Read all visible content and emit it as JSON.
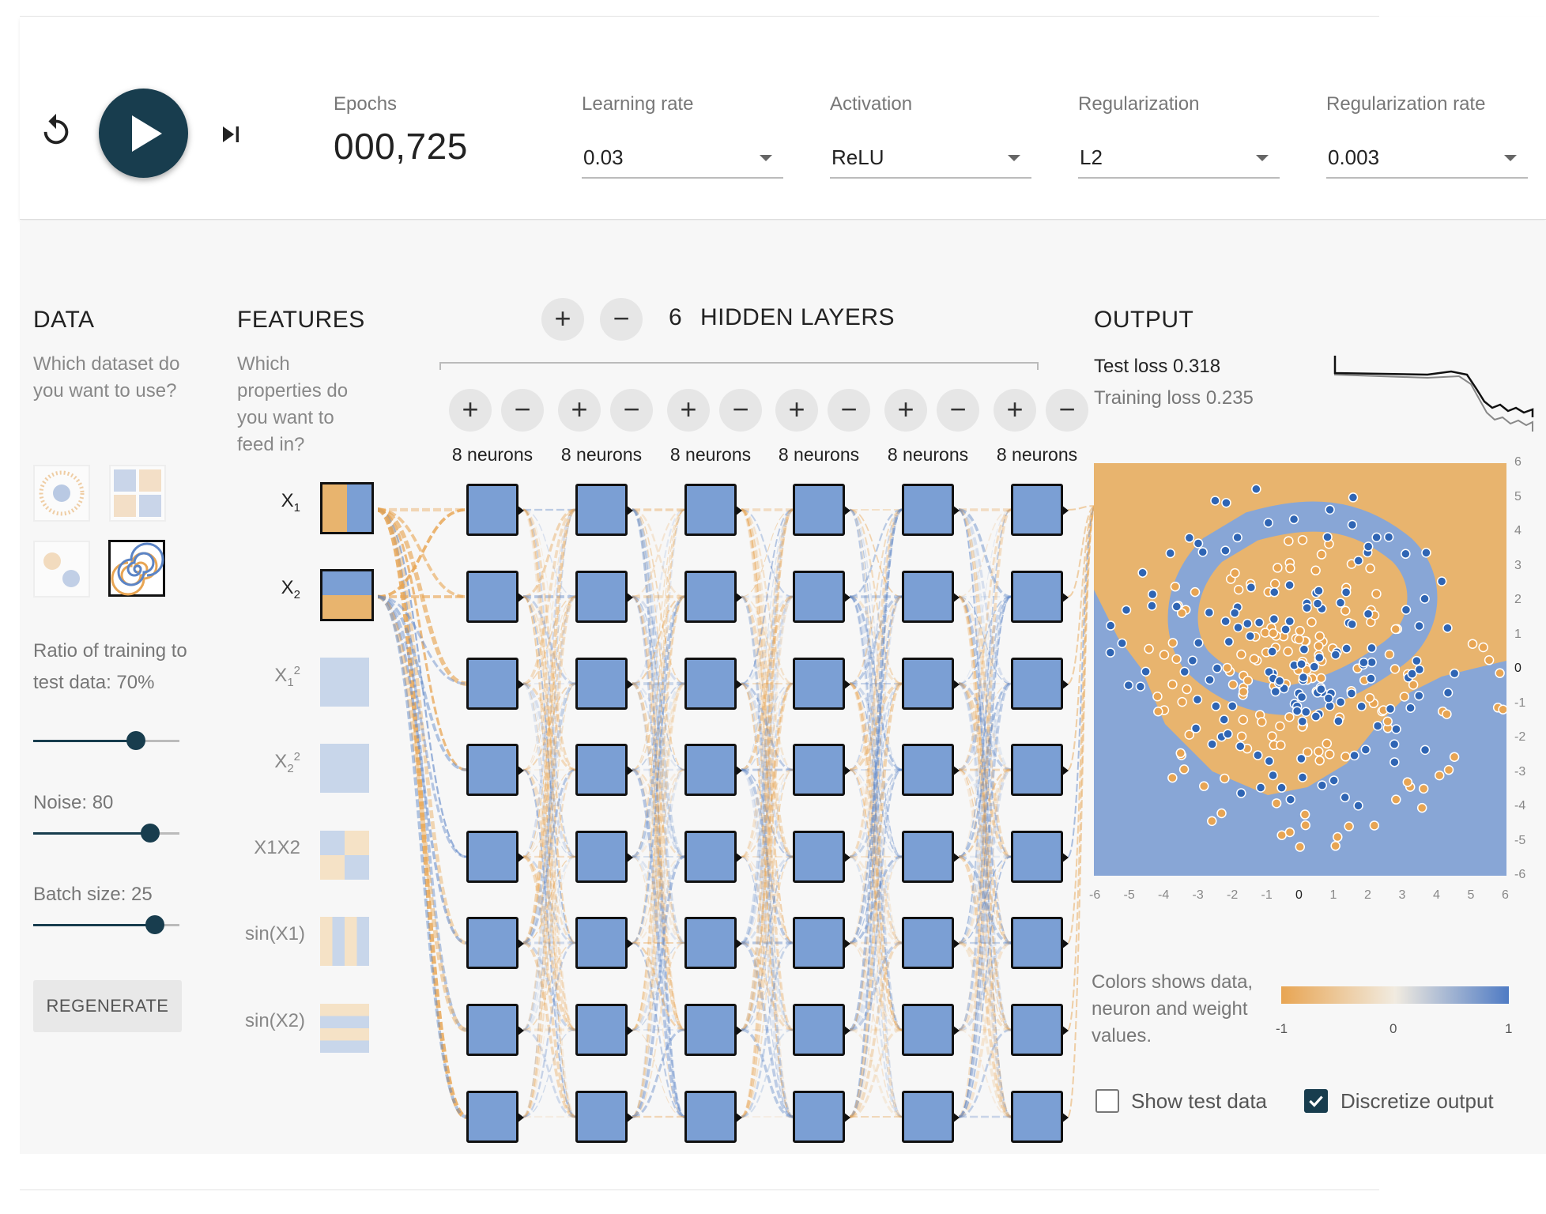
{
  "controls": {
    "epochs_label": "Epochs",
    "epochs_value": "000,725",
    "learning_rate_label": "Learning rate",
    "learning_rate_value": "0.03",
    "activation_label": "Activation",
    "activation_value": "ReLU",
    "regularization_label": "Regularization",
    "regularization_value": "L2",
    "regularization_rate_label": "Regularization rate",
    "regularization_rate_value": "0.003"
  },
  "data_section": {
    "title": "DATA",
    "description": "Which dataset do you want to use?",
    "ratio_label": "Ratio of training to test data:  70%",
    "ratio_value": 0.7,
    "noise_label": "Noise:  80",
    "noise_value": 0.8,
    "batch_label": "Batch size:  25",
    "batch_value": 0.83,
    "regenerate_label": "REGENERATE",
    "selected_dataset": "spiral"
  },
  "features_section": {
    "title": "FEATURES",
    "description": "Which properties do you want to feed in?",
    "features": [
      {
        "label_main": "X",
        "label_sub": "1",
        "label_sup": "",
        "active": true
      },
      {
        "label_main": "X",
        "label_sub": "2",
        "label_sup": "",
        "active": true
      },
      {
        "label_main": "X",
        "label_sub": "1",
        "label_sup": "2",
        "active": false
      },
      {
        "label_main": "X",
        "label_sub": "2",
        "label_sup": "2",
        "active": false
      },
      {
        "label_main": "X1X2",
        "label_sub": "",
        "label_sup": "",
        "active": false
      },
      {
        "label_main": "sin(X1)",
        "label_sub": "",
        "label_sup": "",
        "active": false
      },
      {
        "label_main": "sin(X2)",
        "label_sub": "",
        "label_sup": "",
        "active": false
      }
    ]
  },
  "network": {
    "hidden_layers_count": "6",
    "hidden_layers_label": "HIDDEN LAYERS",
    "add_layer_symbol": "+",
    "remove_layer_symbol": "−",
    "layers": [
      {
        "neurons_label": "8 neurons"
      },
      {
        "neurons_label": "8 neurons"
      },
      {
        "neurons_label": "8 neurons"
      },
      {
        "neurons_label": "8 neurons"
      },
      {
        "neurons_label": "8 neurons"
      },
      {
        "neurons_label": "8 neurons"
      }
    ]
  },
  "output_section": {
    "title": "OUTPUT",
    "test_loss": "Test loss 0.318",
    "training_loss": "Training loss 0.235",
    "legend_text": "Colors shows data, neuron and weight values.",
    "legend_ticks": [
      "-1",
      "0",
      "1"
    ],
    "show_test_data_label": "Show test data",
    "show_test_data_checked": false,
    "discretize_label": "Discretize output",
    "discretize_checked": true,
    "x_ticks": [
      "-6",
      "-5",
      "-4",
      "-3",
      "-2",
      "-1",
      "0",
      "1",
      "2",
      "3",
      "4",
      "5",
      "6"
    ],
    "y_ticks": [
      "6",
      "5",
      "4",
      "3",
      "2",
      "1",
      "0",
      "-1",
      "-2",
      "-3",
      "-4",
      "-5",
      "-6"
    ]
  },
  "colors": {
    "orange": "#e8a553",
    "blue": "#5b84c6",
    "neuron_fill": "#7b9fd4",
    "dark": "#183d4e"
  },
  "icons": {
    "reset": "reset-icon",
    "play": "play-icon",
    "step": "step-forward-icon"
  }
}
